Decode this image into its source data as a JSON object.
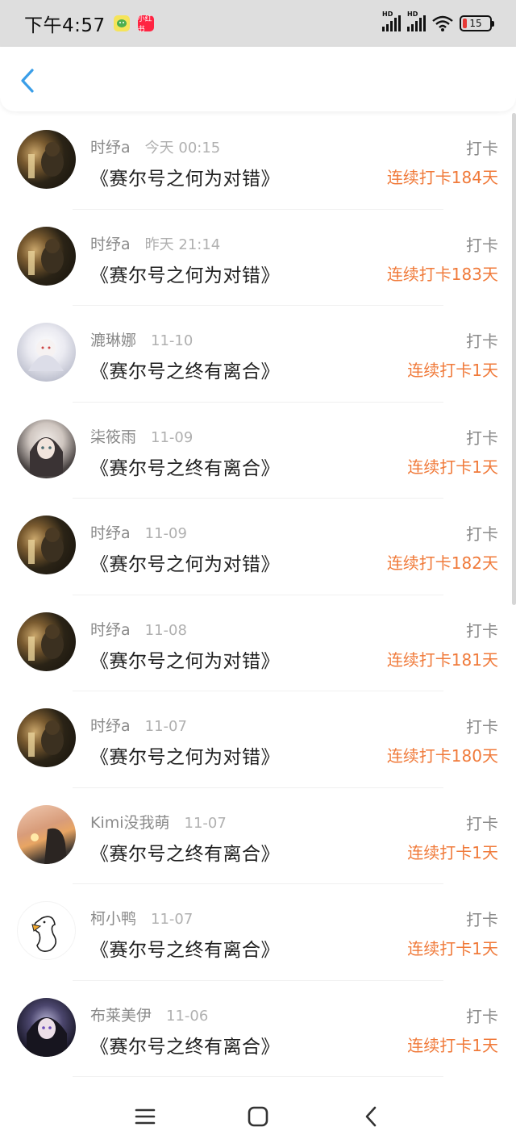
{
  "status_bar": {
    "time": "下午4:57",
    "battery": "15",
    "network_label_1": "HD",
    "network_label_2": "HD",
    "redbook_label": "小红书"
  },
  "nav": {
    "back_icon": "chevron-left-icon"
  },
  "colors": {
    "accent": "#f07a3a",
    "back": "#3a9ee8"
  },
  "items": [
    {
      "name": "时纾a",
      "time": "今天 00:15",
      "title": "《赛尔号之何为对错》",
      "action": "打卡",
      "streak": "连续打卡184天",
      "avatar": "dark"
    },
    {
      "name": "时纾a",
      "time": "昨天 21:14",
      "title": "《赛尔号之何为对错》",
      "action": "打卡",
      "streak": "连续打卡183天",
      "avatar": "dark"
    },
    {
      "name": "漉琳娜",
      "time": "11-10",
      "title": "《赛尔号之终有离合》",
      "action": "打卡",
      "streak": "连续打卡1天",
      "avatar": "white"
    },
    {
      "name": "柒筱雨",
      "time": "11-09",
      "title": "《赛尔号之终有离合》",
      "action": "打卡",
      "streak": "连续打卡1天",
      "avatar": "girl"
    },
    {
      "name": "时纾a",
      "time": "11-09",
      "title": "《赛尔号之何为对错》",
      "action": "打卡",
      "streak": "连续打卡182天",
      "avatar": "dark"
    },
    {
      "name": "时纾a",
      "time": "11-08",
      "title": "《赛尔号之何为对错》",
      "action": "打卡",
      "streak": "连续打卡181天",
      "avatar": "dark"
    },
    {
      "name": "时纾a",
      "time": "11-07",
      "title": "《赛尔号之何为对错》",
      "action": "打卡",
      "streak": "连续打卡180天",
      "avatar": "dark"
    },
    {
      "name": "Kimi没我萌",
      "time": "11-07",
      "title": "《赛尔号之终有离合》",
      "action": "打卡",
      "streak": "连续打卡1天",
      "avatar": "sunset"
    },
    {
      "name": "柯小鸭",
      "time": "11-07",
      "title": "《赛尔号之终有离合》",
      "action": "打卡",
      "streak": "连续打卡1天",
      "avatar": "duck"
    },
    {
      "name": "布莱美伊",
      "time": "11-06",
      "title": "《赛尔号之终有离合》",
      "action": "打卡",
      "streak": "连续打卡1天",
      "avatar": "dark2"
    }
  ]
}
